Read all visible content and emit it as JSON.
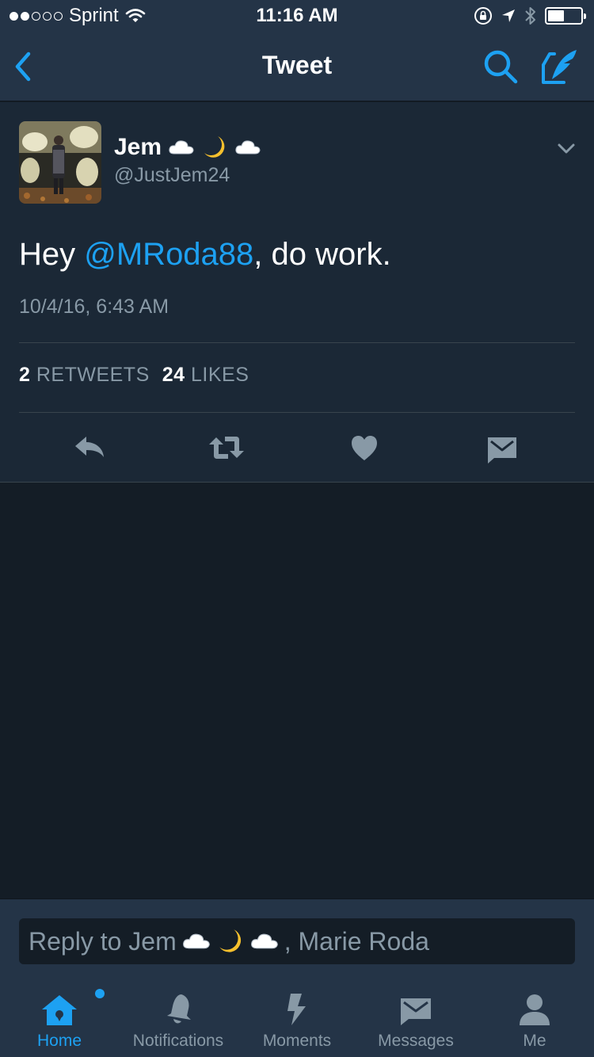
{
  "status_bar": {
    "carrier": "Sprint",
    "time": "11:16 AM",
    "signal_bars_filled": 2,
    "signal_bars_total": 5,
    "battery_level": 0.55
  },
  "nav": {
    "title": "Tweet",
    "back_icon": "chevron-left-icon",
    "search_icon": "search-icon",
    "compose_icon": "compose-tweet-icon"
  },
  "tweet": {
    "author_name": "Jem",
    "author_name_emoji": [
      "☁️",
      "🌙",
      "☁️"
    ],
    "author_handle": "@JustJem24",
    "text_prefix": "Hey ",
    "mention": "@MRoda88",
    "text_suffix": ", do work.",
    "date": "10/4/16, 6:43 AM",
    "retweets_count": "2",
    "retweets_label": "RETWEETS",
    "likes_count": "24",
    "likes_label": "LIKES"
  },
  "reply": {
    "prefix": "Reply to Jem",
    "emoji": [
      "☁️",
      "🌙",
      "☁️"
    ],
    "suffix": ", Marie Roda"
  },
  "tabs": [
    {
      "label": "Home",
      "icon": "home-icon",
      "active": true
    },
    {
      "label": "Notifications",
      "icon": "bell-icon",
      "active": false
    },
    {
      "label": "Moments",
      "icon": "lightning-icon",
      "active": false
    },
    {
      "label": "Messages",
      "icon": "envelope-icon",
      "active": false
    },
    {
      "label": "Me",
      "icon": "person-icon",
      "active": false
    }
  ],
  "colors": {
    "accent": "#1da1f2",
    "background": "#141d26",
    "card": "#1b2836",
    "bar": "#243447",
    "secondary_text": "#8899a6"
  }
}
